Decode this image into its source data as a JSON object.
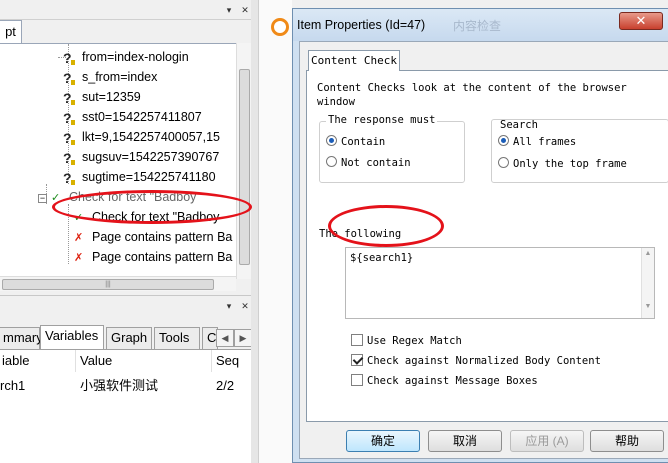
{
  "left_pane": {
    "script_tab_label": "pt",
    "tree_nodes": [
      {
        "label": "from=index-nologin"
      },
      {
        "label": "s_from=index"
      },
      {
        "label": "sut=12359"
      },
      {
        "label": "sst0=1542257411807"
      },
      {
        "label": "lkt=9,1542257400057,15"
      },
      {
        "label": "sugsuv=1542257390767"
      },
      {
        "label": "sugtime=154225741180"
      }
    ],
    "check_nodes": [
      {
        "label": "Check for text \"Badboy"
      },
      {
        "label": "Check for text \"Badboy"
      }
    ],
    "pattern_nodes": [
      {
        "label": "Page contains pattern Ba"
      },
      {
        "label": "Page contains pattern Ba"
      }
    ],
    "tabs": [
      "mmary",
      "Variables",
      "Graph",
      "Tools",
      "C"
    ],
    "active_tab": "Variables",
    "variables_table": {
      "headers": [
        "iable",
        "Value",
        "Seq"
      ],
      "rows": [
        {
          "name": "rch1",
          "value": "小强软件测试",
          "seq": "2/2"
        }
      ]
    }
  },
  "dialog": {
    "title": "Item Properties (Id=47)",
    "title_ghost": "内容检查",
    "close_glyph": "✕",
    "tab_label": "Content Check",
    "intro_line1": "Content Checks look at the content of the browser",
    "intro_line2": "window",
    "response_group": {
      "title": "The response must",
      "options": [
        "Contain",
        "Not contain"
      ],
      "selected": "Contain"
    },
    "search_group": {
      "title": "Search",
      "options": [
        "All frames",
        "Only the top frame"
      ],
      "selected": "All frames"
    },
    "following_label": "The following",
    "following_value": "${search1}",
    "checkboxes": [
      {
        "label": "Use Regex Match",
        "checked": false
      },
      {
        "label": "Check against Normalized Body Content",
        "checked": true
      },
      {
        "label": "Check against Message Boxes",
        "checked": false
      }
    ],
    "buttons": {
      "ok": "确定",
      "cancel": "取消",
      "apply": "应用 (A)",
      "help": "帮助"
    }
  },
  "colors": {
    "annotation_red": "#e4121a",
    "dialog_frame": "#cfe0f1",
    "radio_dot": "#1b5db8",
    "default_button_border": "#3c7fb1"
  }
}
